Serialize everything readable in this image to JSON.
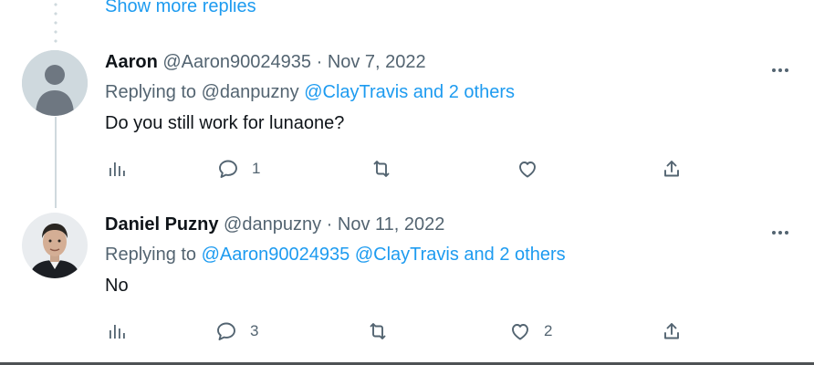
{
  "thread": {
    "show_more_label": "Show more replies"
  },
  "tweets": [
    {
      "name": "Aaron",
      "handle": "@Aaron90024935",
      "separator": "·",
      "date": "Nov 7, 2022",
      "replying_prefix": "Replying to",
      "replying_plain": "@danpuzny",
      "replying_links": "@ClayTravis and 2 others",
      "text": "Do you still work for lunaone?",
      "replies": "1",
      "retweets": "",
      "likes": ""
    },
    {
      "name": "Daniel Puzny",
      "handle": "@danpuzny",
      "separator": "·",
      "date": "Nov 11, 2022",
      "replying_prefix": "Replying to",
      "replying_links": "@Aaron90024935 @ClayTravis and 2 others",
      "text": "No",
      "replies": "3",
      "retweets": "",
      "likes": "2"
    }
  ],
  "icons": {
    "analytics": "bar-chart-icon",
    "reply": "speech-bubble-icon",
    "retweet": "retweet-arrows-icon",
    "like": "heart-icon",
    "share": "share-upload-icon",
    "more": "more-dots-icon"
  },
  "colors": {
    "link": "#1d9bf0",
    "muted": "#536471",
    "text": "#0f1419",
    "thread_line": "#cfd9de"
  }
}
